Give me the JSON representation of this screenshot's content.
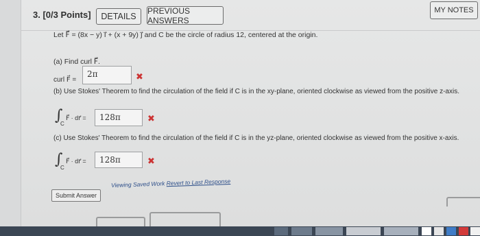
{
  "question": {
    "number_label": "3. [0/3 Points]",
    "details_label": "DETAILS",
    "previous_answers_label": "PREVIOUS ANSWERS",
    "my_notes_label": "MY NOTES"
  },
  "problem": {
    "statement": "Let F⃗ = (8x − y) i⃗ + (x + 9y) j⃗  and C be the circle of radius 12, centered at the origin."
  },
  "part_a": {
    "prompt": "(a) Find  curl F⃗.",
    "answer_label": "curl F⃗  =",
    "answer_value": "2π",
    "result_icon": "✖"
  },
  "part_b": {
    "prompt": "(b) Use Stokes' Theorem to find the circulation of the field if C is in the xy-plane, oriented clockwise as viewed from the positive z-axis.",
    "integral_sub": "C",
    "integral_expr": "F⃗ · dr⃗  =",
    "answer_value": "128π",
    "result_icon": "✖"
  },
  "part_c": {
    "prompt": "(c) Use Stokes' Theorem to find the circulation of the field if C is in the yz-plane, oriented clockwise as viewed from the positive x-axis.",
    "integral_sub": "C",
    "integral_expr": "F⃗ · dr⃗  =",
    "answer_value": "128π",
    "result_icon": "✖"
  },
  "footer": {
    "submit_label": "Submit Answer",
    "viewing_saved": "Viewing Saved Work ",
    "revert_link": "Revert to Last Response"
  },
  "colors": {
    "incorrect_mark": "#cc3333",
    "link": "#2d4f8a",
    "taskbar": "#3b4654"
  }
}
